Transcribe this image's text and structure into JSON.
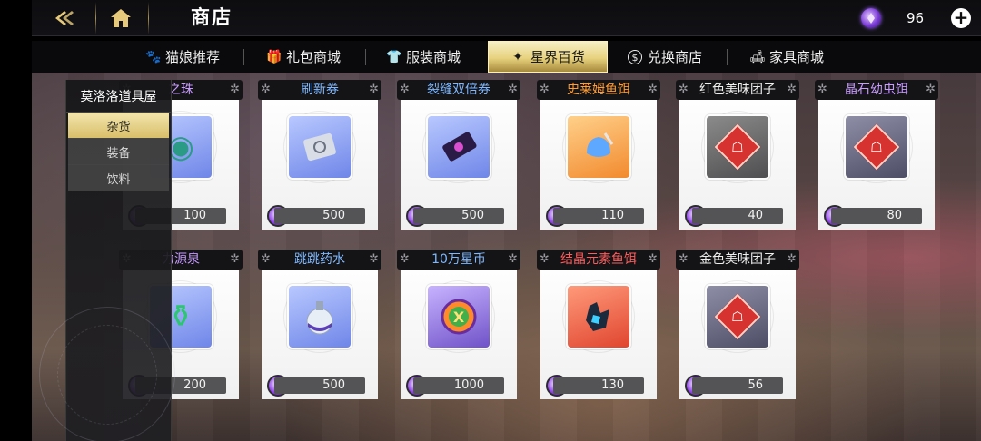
{
  "header": {
    "title": "商店",
    "currency_amount": "96",
    "plus_label": "+"
  },
  "tabs": [
    {
      "label": "猫娘推荐",
      "icon": "cat-icon",
      "glyph": "🐾"
    },
    {
      "label": "礼包商城",
      "icon": "gift-icon",
      "glyph": "🎁"
    },
    {
      "label": "服装商城",
      "icon": "clothing-icon",
      "glyph": "👕"
    },
    {
      "label": "星界百货",
      "icon": "star-icon",
      "glyph": "✦",
      "active": true
    },
    {
      "label": "兑换商店",
      "icon": "coin-icon",
      "glyph": "$"
    },
    {
      "label": "家具商城",
      "icon": "furniture-icon",
      "glyph": "🛋"
    }
  ],
  "side_panel": {
    "title": "莫洛洛道具屋",
    "items": [
      {
        "label": "杂货",
        "active": true
      },
      {
        "label": "装备",
        "active": false
      },
      {
        "label": "饮料",
        "active": false
      }
    ]
  },
  "products": [
    {
      "name": "之珠",
      "price": "100",
      "name_color": "purple",
      "icon": "orb-icon"
    },
    {
      "name": "刷新券",
      "price": "500",
      "name_color": "blue",
      "icon": "refresh-ticket-icon"
    },
    {
      "name": "裂缝双倍券",
      "price": "500",
      "name_color": "blue",
      "icon": "double-ticket-icon"
    },
    {
      "name": "史莱姆鱼饵",
      "price": "110",
      "name_color": "orange",
      "icon": "slime-bait-icon"
    },
    {
      "name": "红色美味团子",
      "price": "40",
      "name_color": "white",
      "icon": "red-dango-icon"
    },
    {
      "name": "晶石幼虫饵",
      "price": "80",
      "name_color": "purple",
      "icon": "crystal-larva-bait-icon"
    },
    {
      "name": "力源泉",
      "price": "200",
      "name_color": "purple",
      "icon": "spring-potion-icon"
    },
    {
      "name": "跳跳药水",
      "price": "500",
      "name_color": "blue",
      "icon": "jump-potion-icon"
    },
    {
      "name": "10万星币",
      "price": "1000",
      "name_color": "blue",
      "icon": "star-coin-icon"
    },
    {
      "name": "结晶元素鱼饵",
      "price": "130",
      "name_color": "red",
      "icon": "crystal-element-bait-icon"
    },
    {
      "name": "金色美味团子",
      "price": "56",
      "name_color": "white",
      "icon": "gold-dango-icon"
    }
  ],
  "colors": {
    "accent_gold": "#e7d27e",
    "price_bar": "#545456",
    "gem_purple": "#9042e8"
  }
}
